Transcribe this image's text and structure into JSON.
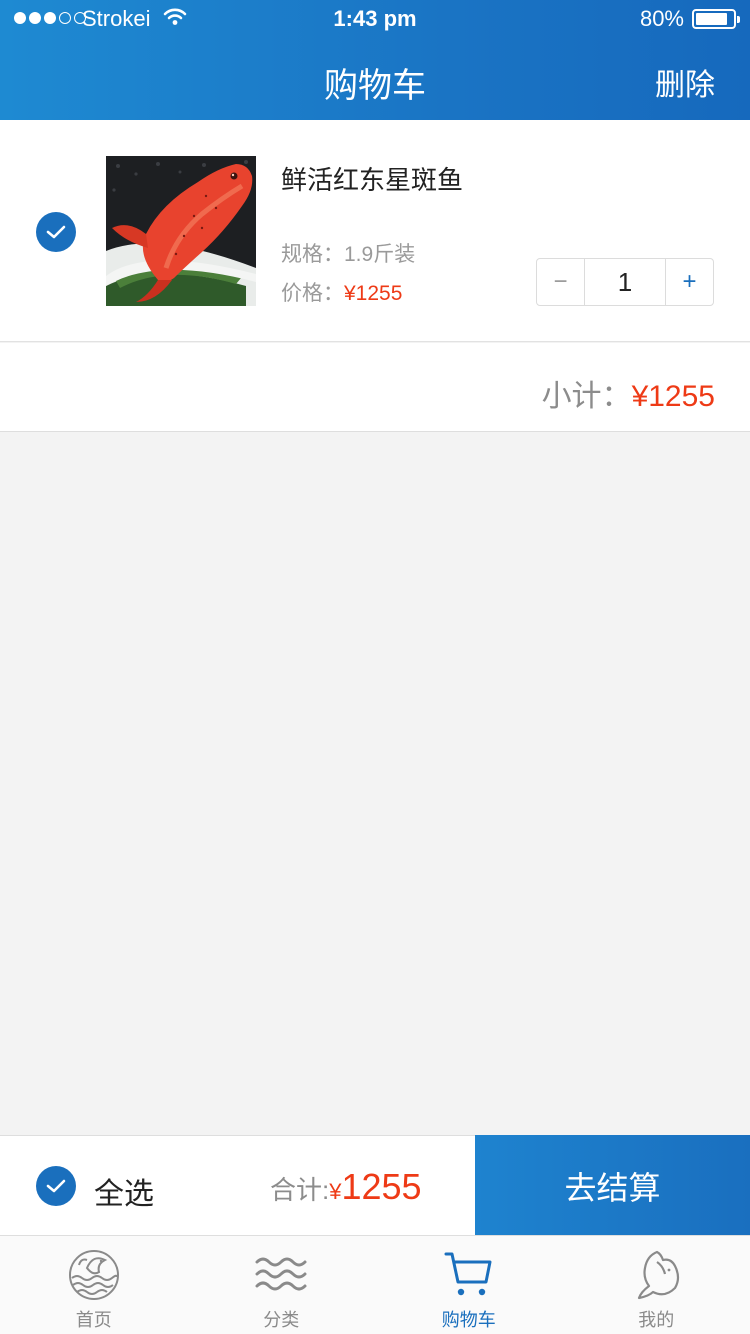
{
  "status_bar": {
    "carrier": "Strokei",
    "time": "1:43 pm",
    "battery": "80%",
    "battery_level": 0.8,
    "signal_bars_filled": 3,
    "signal_bars_total": 5
  },
  "header": {
    "title": "购物车",
    "delete_label": "删除"
  },
  "cart_item": {
    "checked": true,
    "name": "鲜活红东星斑鱼",
    "spec_label": "规格：",
    "spec_value": "1.9斤装",
    "price_label": "价格：",
    "price_value": "¥1255",
    "quantity": "1",
    "minus_symbol": "−",
    "plus_symbol": "+"
  },
  "subtotal": {
    "label": "小计：",
    "value": "¥1255"
  },
  "checkout": {
    "select_all_label": "全选",
    "select_all_checked": true,
    "total_label": "合计:",
    "currency": "¥",
    "total_value": "1255",
    "button_label": "去结算"
  },
  "tab_bar": {
    "items": [
      {
        "label": "首页",
        "icon": "fish-plate-icon",
        "active": false
      },
      {
        "label": "分类",
        "icon": "waves-icon",
        "active": false
      },
      {
        "label": "购物车",
        "icon": "cart-icon",
        "active": true
      },
      {
        "label": "我的",
        "icon": "fish-profile-icon",
        "active": false
      }
    ]
  },
  "colors": {
    "brand_blue": "#1a6fbd",
    "price_red": "#ee3a16",
    "muted_gray": "#9a9a9a",
    "background": "#f3f3f3"
  }
}
